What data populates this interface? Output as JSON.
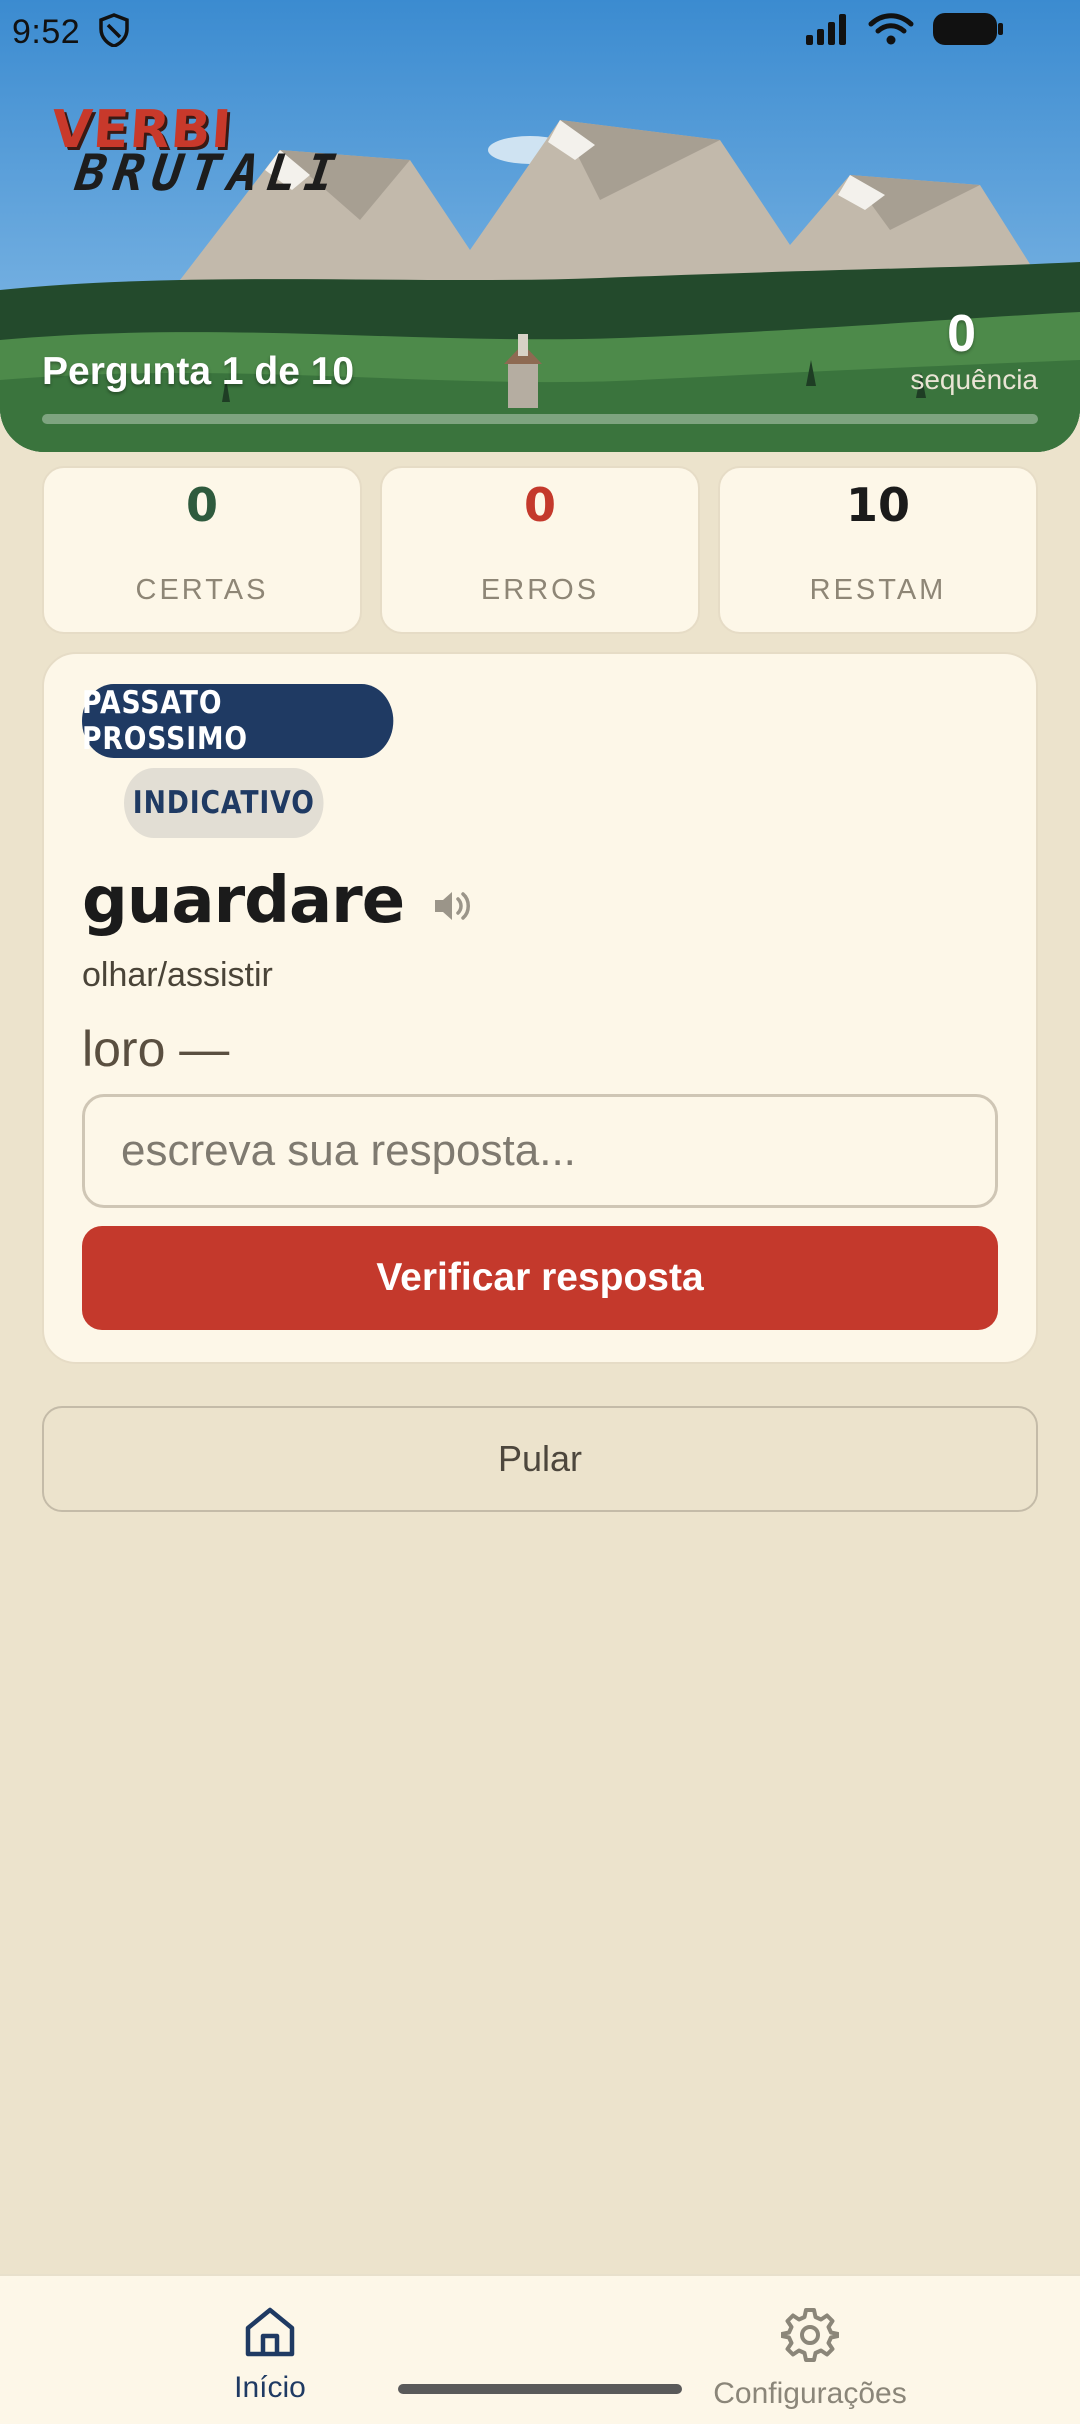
{
  "status_bar": {
    "time": "9:52"
  },
  "header": {
    "logo_line1": "VERBI",
    "logo_line2": "BRUTALI",
    "progress_label": "Pergunta 1 de 10",
    "progress_fraction": 0,
    "streak_value": "0",
    "streak_label": "sequência"
  },
  "stats": [
    {
      "value": "0",
      "label": "CERTAS",
      "color": "#2e5a3d"
    },
    {
      "value": "0",
      "label": "ERROS",
      "color": "#c4392c"
    },
    {
      "value": "10",
      "label": "RESTAM",
      "color": "#1b1b1b"
    }
  ],
  "question": {
    "tense": "PASSATO PROSSIMO",
    "mood": "INDICATIVO",
    "verb": "guardare",
    "translation": "olhar/assistir",
    "pronoun": "loro —",
    "input_placeholder": "escreva sua resposta...",
    "check_label": "Verificar resposta"
  },
  "skip_label": "Pular",
  "nav": {
    "home_label": "Início",
    "home_icon": "home-icon",
    "settings_label": "Configurações",
    "settings_icon": "gear-icon"
  },
  "colors": {
    "primary_red": "#c4392c",
    "navy": "#1f3a63",
    "background": "#ece3cc",
    "card": "#fdf7e8"
  }
}
